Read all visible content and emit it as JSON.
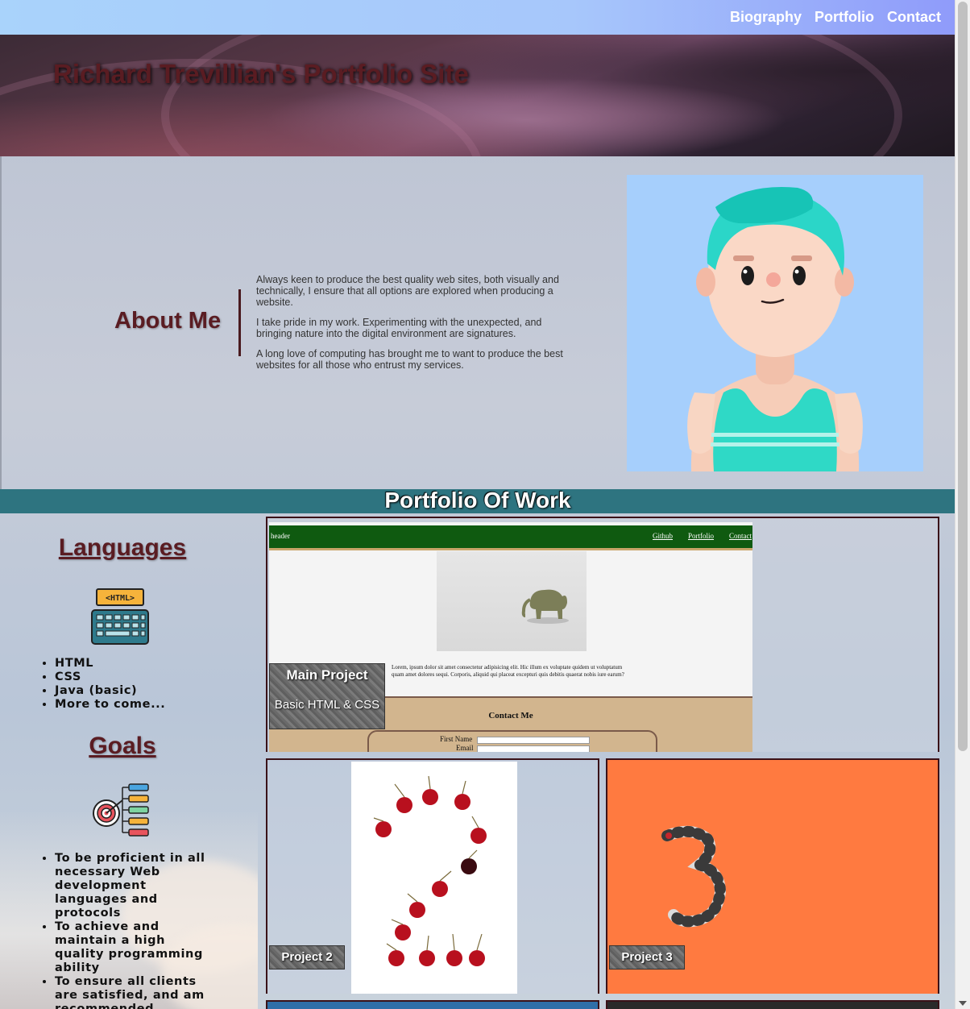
{
  "nav": {
    "links": [
      "Biography",
      "Portfolio",
      "Contact"
    ]
  },
  "header": {
    "title": "Richard Trevillian's Portfolio Site"
  },
  "about": {
    "heading": "About Me",
    "paragraphs": [
      "Always keen to produce the best quality web sites, both visually and technically, I ensure that all options are explored when producing a website.",
      "I take pride in my work. Experimenting with the unexpected, and bringing nature into the digital environment are signatures.",
      "A long love of computing has brought me to want to produce the best websites for all those who entrust my services."
    ]
  },
  "portfolio": {
    "heading": "Portfolio Of Work",
    "main_project": {
      "title": "Main Project",
      "subtitle": "Basic HTML & CSS",
      "mock": {
        "header_text": "header",
        "links": [
          "Github",
          "Portfolio",
          "Contact"
        ],
        "paragraph": "Lorem, ipsum dolor sit amet consectetur adipisicing elit. Hic illum ex voluptate quidem ut voluptatum quam amet dolores sequi. Corporis, aliquid qui placeat excepturi quis debitis quaerat nobis iure earum?",
        "contact_title": "Contact Me",
        "first_name_label": "First Name",
        "email_label": "Email"
      }
    },
    "projects": [
      {
        "label": "Project 2"
      },
      {
        "label": "Project 3"
      }
    ]
  },
  "sidebar": {
    "languages": {
      "heading": "Languages",
      "icon_text": "<HTML>",
      "items": [
        "HTML",
        "CSS",
        "Java (basic)",
        "More to come..."
      ]
    },
    "goals": {
      "heading": "Goals",
      "items": [
        "To be proficient in all necessary Web development languages and protocols",
        "To achieve and maintain a high quality programming ability",
        "To ensure all clients are satisfied, and am recommended through"
      ]
    }
  },
  "colors": {
    "nav_gradient_start": "#a9d3fb",
    "nav_gradient_end": "#8f9bfa",
    "heading_maroon": "#5a1c22",
    "band_teal": "#2e7480",
    "project3_orange": "#ff7a40"
  }
}
